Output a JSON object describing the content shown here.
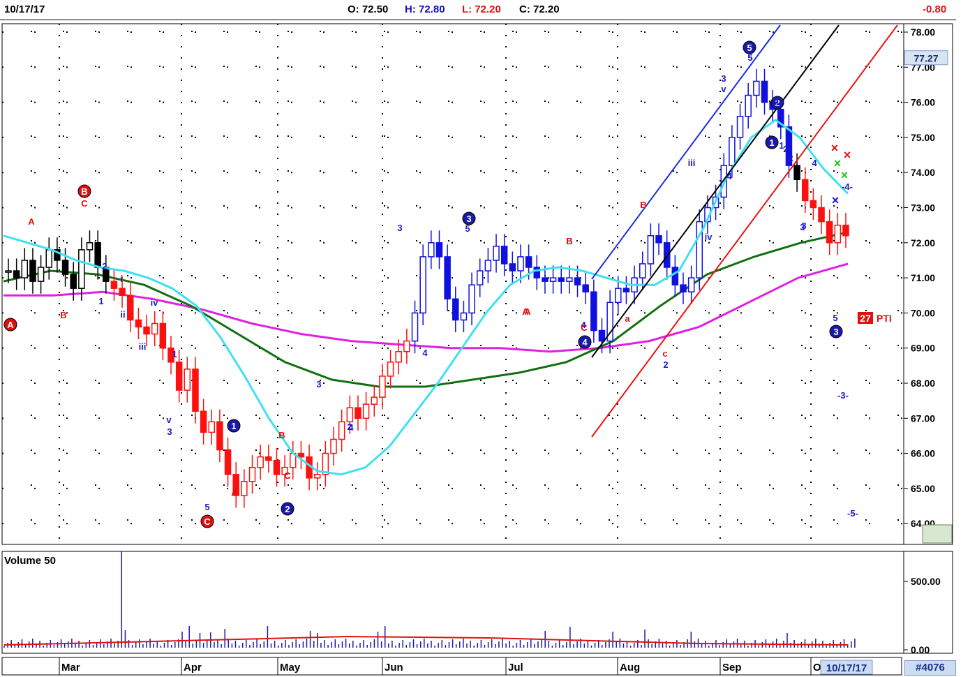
{
  "header": {
    "date": "10/17/17",
    "open": "O: 72.50",
    "high": "H: 72.80",
    "low": "L: 72.20",
    "close": "C: 72.20",
    "change": "-0.80"
  },
  "footer": {
    "date_box": "10/17/17",
    "id": "#4076"
  },
  "price_badge": "77.27",
  "volume_label": "Volume 50",
  "pti": {
    "value": "27",
    "label": "PTI"
  },
  "colors": {
    "up": "#1010e0",
    "down": "#ff1010",
    "neutral": "#000000",
    "ma_short": "#40e0f0",
    "ma_mid": "#107010",
    "ma_long": "#e020e0",
    "channel_blue": "#1a2ee0",
    "channel_black": "#000000",
    "channel_red": "#ee1111"
  },
  "chart_data": {
    "type": "candlestick",
    "x_tick_labels": [
      "Mar",
      "Apr",
      "May",
      "Jun",
      "Jul",
      "Aug",
      "Sep",
      "O"
    ],
    "y_ticks": [
      "78.00",
      "77.00",
      "76.00",
      "75.00",
      "74.00",
      "73.00",
      "72.00",
      "71.00",
      "70.00",
      "69.00",
      "68.00",
      "67.00",
      "66.00",
      "65.00",
      "64.00"
    ],
    "ylim": [
      64,
      78
    ],
    "volume_ticks": [
      "500.00",
      "0.00"
    ],
    "close_series": [
      71.2,
      71.0,
      71.5,
      70.9,
      71.3,
      71.8,
      71.5,
      71.1,
      70.7,
      71.8,
      72.0,
      71.3,
      70.9,
      70.7,
      70.5,
      69.8,
      69.6,
      69.4,
      69.7,
      69.0,
      68.6,
      67.8,
      68.4,
      67.2,
      66.6,
      66.9,
      66.1,
      65.4,
      64.8,
      65.2,
      65.6,
      65.9,
      65.8,
      65.4,
      65.6,
      66.0,
      65.9,
      65.3,
      65.4,
      66.0,
      66.4,
      66.9,
      67.3,
      67.0,
      67.4,
      67.6,
      68.2,
      68.6,
      68.9,
      69.2,
      70.0,
      71.6,
      72.0,
      71.6,
      70.4,
      69.8,
      70.0,
      70.8,
      71.2,
      71.5,
      71.9,
      71.4,
      71.2,
      71.6,
      71.3,
      71.0,
      70.9,
      71.0,
      70.9,
      71.0,
      70.8,
      70.6,
      69.5,
      69.2,
      70.3,
      70.7,
      70.6,
      71.0,
      71.4,
      72.2,
      72.0,
      71.3,
      70.8,
      70.6,
      71.0,
      72.6,
      73.0,
      73.3,
      74.2,
      75.0,
      75.6,
      76.2,
      76.6,
      76.0,
      75.8,
      75.3,
      74.2,
      73.8,
      73.2,
      73.0,
      72.6,
      72.0,
      72.5,
      72.2
    ],
    "ma_short": [
      72.2,
      72.0,
      71.8,
      71.5,
      71.3,
      71.2,
      71.0,
      70.7,
      70.2,
      69.3,
      68.2,
      67.0,
      66.0,
      65.5,
      65.4,
      65.6,
      66.2,
      67.1,
      68.0,
      69.0,
      70.0,
      70.8,
      71.2,
      71.3,
      71.2,
      71.0,
      70.8,
      70.8,
      71.2,
      72.4,
      73.9,
      75.0,
      75.5,
      75.0,
      74.1,
      73.4
    ],
    "ma_mid": [
      70.9,
      71.2,
      71.1,
      70.8,
      70.2,
      69.4,
      68.6,
      68.1,
      67.9,
      67.9,
      68.1,
      68.3,
      68.6,
      69.2,
      70.2,
      71.1,
      71.6,
      72.0,
      72.3
    ],
    "ma_long": [
      70.5,
      70.5,
      70.6,
      70.4,
      70.1,
      69.7,
      69.4,
      69.2,
      69.1,
      69.0,
      69.0,
      68.9,
      69.0,
      69.2,
      69.6,
      70.3,
      71.0,
      71.4
    ],
    "wave_labels_blue": [
      "1",
      "2",
      "3",
      "4",
      "5",
      "i",
      "ii",
      "iii",
      "iv",
      "v",
      "3",
      "1",
      "2",
      "3",
      "4",
      "5",
      "2",
      "1",
      "3",
      "4",
      "5",
      "iii",
      "iv",
      "3",
      "v",
      "5",
      "2",
      "1",
      "4",
      "3",
      "5",
      "4",
      "-4-",
      "-3-",
      "-5-"
    ],
    "wave_labels_red": [
      "A",
      "B",
      "C",
      "A",
      "B",
      "C",
      "A",
      "B",
      "C",
      "a",
      "c",
      "B",
      "A",
      "C",
      "B"
    ],
    "circle_labels": [
      {
        "text": "A",
        "color": "red"
      },
      {
        "text": "B",
        "color": "red"
      },
      {
        "text": "C",
        "color": "red"
      },
      {
        "text": "1",
        "color": "blue"
      },
      {
        "text": "2",
        "color": "blue"
      },
      {
        "text": "3",
        "color": "blue"
      },
      {
        "text": "4",
        "color": "blue"
      },
      {
        "text": "5",
        "color": "blue"
      },
      {
        "text": "2",
        "color": "blue"
      },
      {
        "text": "1",
        "color": "blue"
      },
      {
        "text": "3",
        "color": "blue"
      }
    ],
    "volume_spike": 760
  }
}
